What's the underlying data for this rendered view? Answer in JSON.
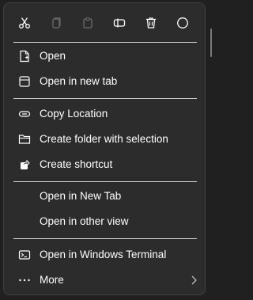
{
  "toolbar": {
    "buttons": [
      {
        "name": "cut",
        "icon": "scissors-icon",
        "enabled": true
      },
      {
        "name": "copy",
        "icon": "copy-icon",
        "enabled": false
      },
      {
        "name": "paste",
        "icon": "paste-icon",
        "enabled": false
      },
      {
        "name": "rename",
        "icon": "rename-icon",
        "enabled": true
      },
      {
        "name": "delete",
        "icon": "trash-icon",
        "enabled": true
      },
      {
        "name": "properties",
        "icon": "circle-icon",
        "enabled": true
      }
    ]
  },
  "menu": {
    "open": "Open",
    "open_new_tab": "Open in new tab",
    "copy_location": "Copy Location",
    "create_folder": "Create folder with selection",
    "create_shortcut": "Create shortcut",
    "open_in_new_tab_2": "Open in New Tab",
    "open_other_view": "Open in other view",
    "open_terminal": "Open in Windows Terminal",
    "more": "More"
  },
  "colors": {
    "background": "#2c2c2c",
    "text": "#ffffff",
    "disabled": "#6b6b6b",
    "separator": "#cfcfcf"
  }
}
